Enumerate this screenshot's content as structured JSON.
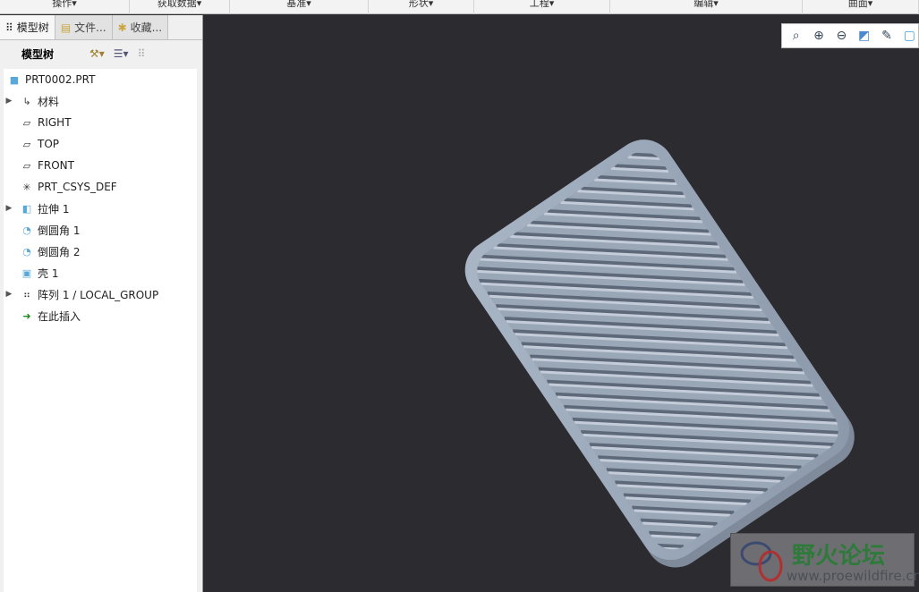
{
  "ribbon": [
    "操作",
    "获取数据",
    "基准",
    "形状",
    "工程",
    "编辑",
    "曲面"
  ],
  "tabs": [
    {
      "label": "模型树"
    },
    {
      "label": "文件..."
    },
    {
      "label": "收藏..."
    }
  ],
  "toolbar": {
    "title": "模型树"
  },
  "tree": [
    {
      "label": "PRT0002.PRT",
      "icon": "part-icon",
      "expand": false,
      "root": true
    },
    {
      "label": "材料",
      "icon": "material-icon",
      "expand": true
    },
    {
      "label": "RIGHT",
      "icon": "datum-plane-icon",
      "expand": false
    },
    {
      "label": "TOP",
      "icon": "datum-plane-icon",
      "expand": false
    },
    {
      "label": "FRONT",
      "icon": "datum-plane-icon",
      "expand": false
    },
    {
      "label": "PRT_CSYS_DEF",
      "icon": "csys-icon",
      "expand": false
    },
    {
      "label": "拉伸 1",
      "icon": "extrude-icon",
      "expand": true
    },
    {
      "label": "倒圆角 1",
      "icon": "round-icon",
      "expand": false
    },
    {
      "label": "倒圆角 2",
      "icon": "round-icon",
      "expand": false
    },
    {
      "label": "壳 1",
      "icon": "shell-icon",
      "expand": false
    },
    {
      "label": "阵列 1 / LOCAL_GROUP",
      "icon": "pattern-icon",
      "expand": true
    },
    {
      "label": "在此插入",
      "icon": "insert-arrow-icon",
      "expand": false
    }
  ],
  "watermark": {
    "title": "野火论坛",
    "url": "www.proewildfire.cn"
  }
}
